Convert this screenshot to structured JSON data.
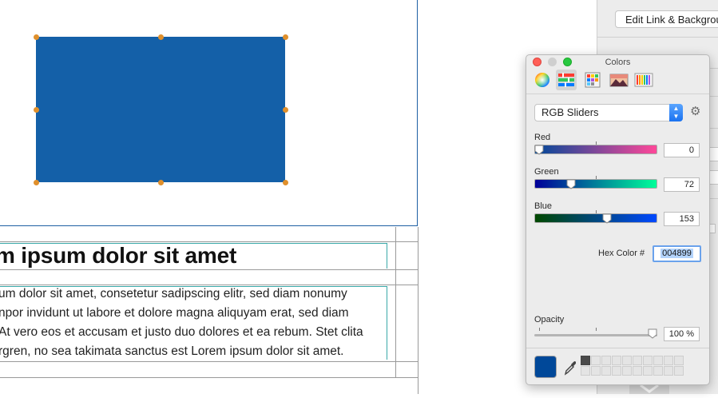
{
  "document": {
    "heading": "m ipsum dolor sit amet",
    "paragraph_lines": [
      "um dolor sit amet, consetetur sadipscing elitr, sed diam nonumy",
      "npor invidunt ut labore et dolore magna aliquyam erat, sed diam",
      "At vero eos et accusam et justo duo dolores et ea rebum. Stet clita",
      "rgren, no sea takimata sanctus est Lorem ipsum dolor sit amet."
    ],
    "shape_color": "#1460a8"
  },
  "inspector": {
    "edit_button_label": "Edit Link & Background..."
  },
  "colors_panel": {
    "title": "Colors",
    "tabs": [
      {
        "icon": "color-wheel-icon",
        "active": false
      },
      {
        "icon": "color-sliders-icon",
        "active": true
      },
      {
        "icon": "color-palettes-icon",
        "active": false
      },
      {
        "icon": "image-palettes-icon",
        "active": false
      },
      {
        "icon": "crayons-icon",
        "active": false
      }
    ],
    "mode": "RGB Sliders",
    "sliders": [
      {
        "label": "Red",
        "value": "0",
        "fraction": 0.0
      },
      {
        "label": "Green",
        "value": "72",
        "fraction": 0.282
      },
      {
        "label": "Blue",
        "value": "153",
        "fraction": 0.6
      }
    ],
    "hex_label": "Hex Color #",
    "hex_value": "004899",
    "opacity_label": "Opacity",
    "opacity_value": "100 %",
    "opacity_fraction": 1.0,
    "current_color": "#004899"
  }
}
